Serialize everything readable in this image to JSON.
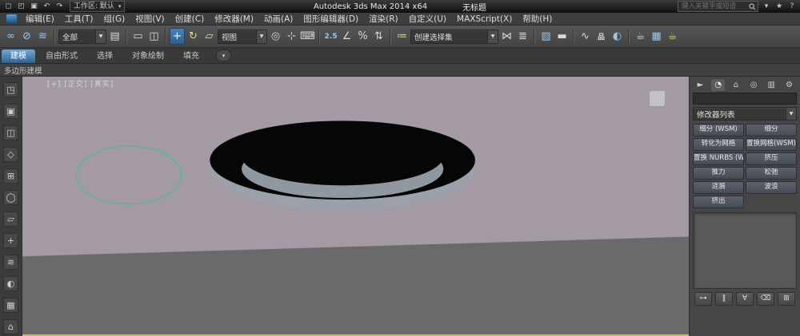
{
  "ui": {
    "caret": "▼",
    "small_caret": "▾"
  },
  "titlebar": {
    "workspace": "工作区: 默认",
    "app_title": "Autodesk 3ds Max  2014 x64",
    "doc_title": "无标题",
    "search_placeholder": "键入关键字或短语"
  },
  "qat": {
    "icons": [
      {
        "n": "new-scene-icon",
        "g": "◻"
      },
      {
        "n": "open-file-icon",
        "g": "◰"
      },
      {
        "n": "save-file-icon",
        "g": "▣"
      },
      {
        "n": "undo-icon",
        "g": "↶"
      },
      {
        "n": "redo-icon",
        "g": "↷"
      }
    ]
  },
  "infocenter": {
    "icons": [
      {
        "n": "signin-icon",
        "g": "▾"
      },
      {
        "n": "favorites-icon",
        "g": "★"
      },
      {
        "n": "help-icon",
        "g": "?"
      }
    ]
  },
  "menubar": {
    "items": [
      "编辑(E)",
      "工具(T)",
      "组(G)",
      "视图(V)",
      "创建(C)",
      "修改器(M)",
      "动画(A)",
      "图形编辑器(D)",
      "渲染(R)",
      "自定义(U)",
      "MAXScript(X)",
      "帮助(H)"
    ]
  },
  "toolbar": {
    "selection_filter": "全部",
    "coord_system": "视图",
    "named_sets": "创建选择集",
    "icons": [
      {
        "n": "select-and-link-icon",
        "g": "∞"
      },
      {
        "n": "unlink-selection-icon",
        "g": "⊘"
      },
      {
        "n": "bind-to-spacewarp-icon",
        "g": "≋"
      },
      {
        "n": "select-by-name-icon",
        "g": "▤"
      },
      {
        "n": "rectangular-selection-region-icon",
        "g": "▭"
      },
      {
        "n": "window-crossing-icon",
        "g": "◫"
      },
      {
        "n": "select-and-move-icon",
        "g": "+"
      },
      {
        "n": "select-and-rotate-icon",
        "g": "↻"
      },
      {
        "n": "select-and-scale-icon",
        "g": "▱"
      },
      {
        "n": "use-pivot-point-center-icon",
        "g": "◎"
      },
      {
        "n": "select-and-manipulate-icon",
        "g": "⊹"
      },
      {
        "n": "keyboard-shortcut-override-icon",
        "g": "⌨"
      },
      {
        "n": "snaps-toggle-icon",
        "g": "2.5"
      },
      {
        "n": "angle-snap-icon",
        "g": "∠"
      },
      {
        "n": "percent-snap-icon",
        "g": "%"
      },
      {
        "n": "spinner-snap-icon",
        "g": "⇅"
      },
      {
        "n": "edit-named-selection-sets-icon",
        "g": "≔"
      },
      {
        "n": "mirror-icon",
        "g": "⋈"
      },
      {
        "n": "align-icon",
        "g": "≣"
      },
      {
        "n": "layer-manager-icon",
        "g": "▧"
      },
      {
        "n": "ribbon-toggle-icon",
        "g": "▬"
      },
      {
        "n": "curve-editor-icon",
        "g": "∿"
      },
      {
        "n": "schematic-view-icon",
        "g": "品"
      },
      {
        "n": "material-editor-icon",
        "g": "◐"
      },
      {
        "n": "render-setup-icon",
        "g": "☕"
      },
      {
        "n": "rendered-frame-window-icon",
        "g": "▦"
      },
      {
        "n": "render-production-icon",
        "g": "☕"
      }
    ]
  },
  "ribbon": {
    "tabs": [
      "建模",
      "自由形式",
      "选择",
      "对象绘制",
      "填充"
    ],
    "panel_title": "多边形建模"
  },
  "left_strip": {
    "icons": [
      {
        "g": "◳"
      },
      {
        "g": "▣"
      },
      {
        "g": "◫"
      },
      {
        "g": "◇"
      },
      {
        "g": "⊞"
      },
      {
        "g": "◯"
      },
      {
        "g": "▱"
      },
      {
        "g": "+"
      },
      {
        "g": "≋"
      },
      {
        "g": "◐"
      },
      {
        "g": "▦"
      },
      {
        "g": "⌂"
      }
    ]
  },
  "viewport": {
    "label": "[+] [正交] [真实]"
  },
  "command_panel": {
    "tabs": [
      {
        "n": "create-tab",
        "g": "►"
      },
      {
        "n": "modify-tab",
        "g": "◔"
      },
      {
        "n": "hierarchy-tab",
        "g": "⌂"
      },
      {
        "n": "motion-tab",
        "g": "◎"
      },
      {
        "n": "display-tab",
        "g": "▥"
      },
      {
        "n": "utilities-tab",
        "g": "⚙"
      }
    ],
    "modifier_list": "修改器列表",
    "modifier_buttons": [
      "细分 (WSM)",
      "细分",
      "转化为网格",
      "置换网格(WSM)",
      "置换 NURBS (WSM",
      "挤压",
      "推力",
      "松弛",
      "涟漪",
      "波浪",
      "挤出"
    ],
    "stack_controls": [
      {
        "n": "pin-stack-icon",
        "g": "⊶"
      },
      {
        "n": "show-end-result-icon",
        "g": "‖"
      },
      {
        "n": "make-unique-icon",
        "g": "∀"
      },
      {
        "n": "remove-modifier-icon",
        "g": "⌫"
      },
      {
        "n": "configure-modifier-sets-icon",
        "g": "⊞"
      }
    ]
  },
  "colors": {
    "active_tool_blue": "#2e6da0",
    "viewport_background": "#a39aa3",
    "ground_gray": "#6a6a6a",
    "spline_teal": "#4db9a0",
    "active_viewport_border": "#c9bd4a"
  }
}
